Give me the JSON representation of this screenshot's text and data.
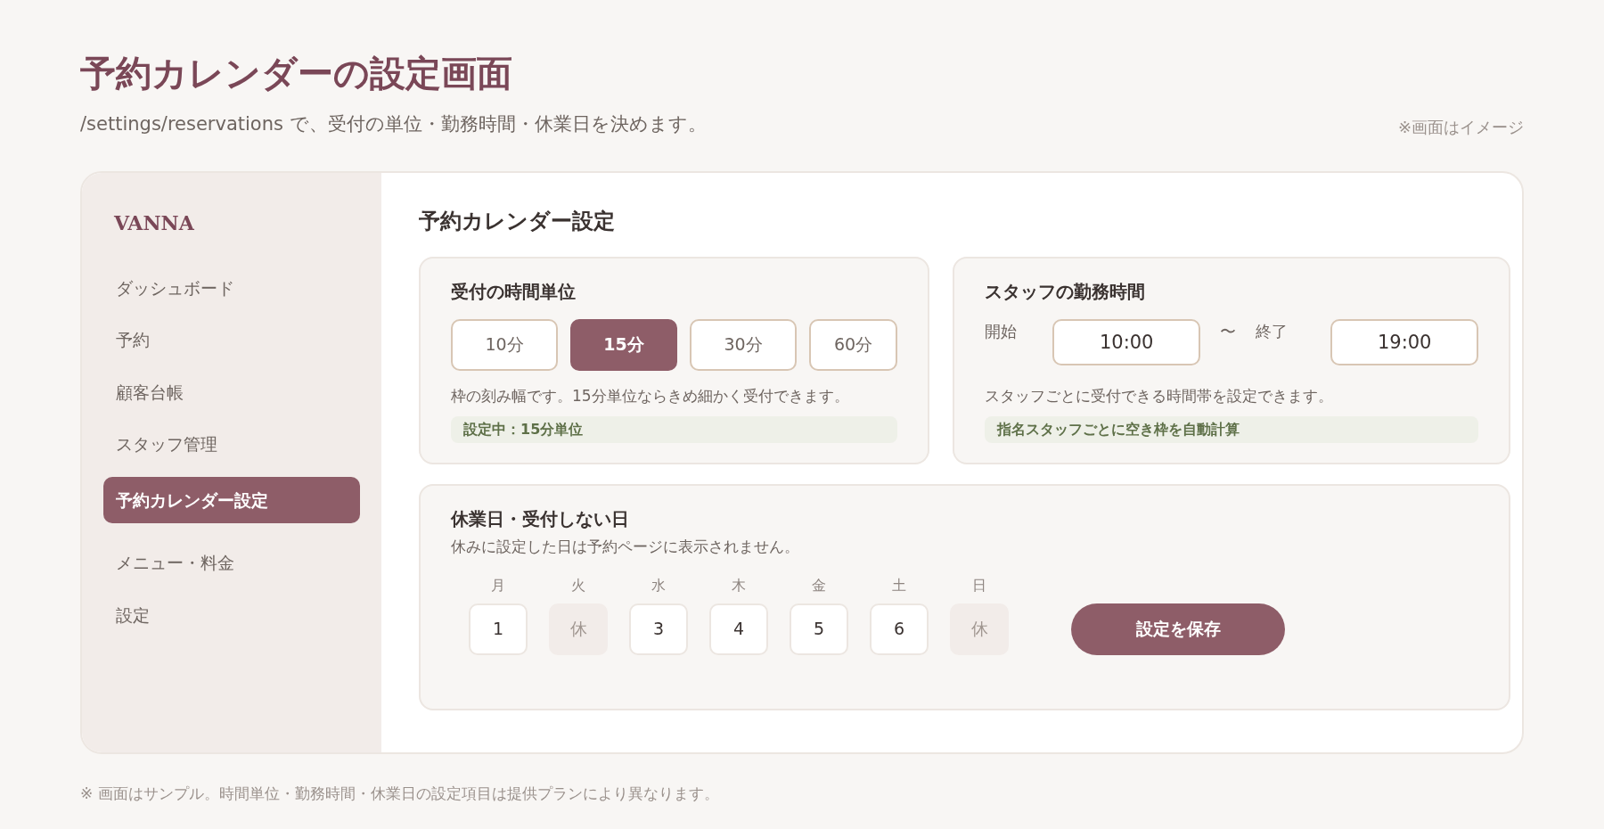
{
  "page": {
    "title": "予約カレンダーの設定画面",
    "subtitle": "/settings/reservations で、受付の単位・勤務時間・休業日を決めます。",
    "note": "※画面はイメージ"
  },
  "sidebar": {
    "brand": "VANNA",
    "items": [
      {
        "label": "ダッシュボード",
        "selected": false
      },
      {
        "label": "予約",
        "selected": false
      },
      {
        "label": "顧客台帳",
        "selected": false
      },
      {
        "label": "スタッフ管理",
        "selected": false
      },
      {
        "label": "予約カレンダー設定",
        "selected": true
      },
      {
        "label": "メニュー・料金",
        "selected": false
      },
      {
        "label": "設定",
        "selected": false
      }
    ]
  },
  "main": {
    "title": "予約カレンダー設定",
    "time_unit": {
      "title": "受付の時間単位",
      "options": [
        {
          "label": "10分",
          "selected": false
        },
        {
          "label": "15分",
          "selected": true
        },
        {
          "label": "30分",
          "selected": false
        },
        {
          "label": "60分",
          "selected": false
        }
      ],
      "description": "枠の刻み幅です。15分単位ならきめ細かく受付できます。",
      "status": "設定中：15分単位"
    },
    "work_hours": {
      "title": "スタッフの勤務時間",
      "start_label": "開始",
      "start_value": "10:00",
      "separator": "〜",
      "end_label": "終了",
      "end_value": "19:00",
      "description": "スタッフごとに受付できる時間帯を設定できます。",
      "status": "指名スタッフごとに空き枠を自動計算"
    },
    "holidays": {
      "title": "休業日・受付しない日",
      "description": "休みに設定した日は予約ページに表示されません。",
      "days": [
        {
          "weekday": "月",
          "value": "1",
          "closed": false
        },
        {
          "weekday": "火",
          "value": "休",
          "closed": true
        },
        {
          "weekday": "水",
          "value": "3",
          "closed": false
        },
        {
          "weekday": "木",
          "value": "4",
          "closed": false
        },
        {
          "weekday": "金",
          "value": "5",
          "closed": false
        },
        {
          "weekday": "土",
          "value": "6",
          "closed": false
        },
        {
          "weekday": "日",
          "value": "休",
          "closed": true
        }
      ],
      "save_button": "設定を保存"
    }
  },
  "footer": "※ 画面はサンプル。時間単位・勤務時間・休業日の設定項目は提供プランにより異なります。"
}
